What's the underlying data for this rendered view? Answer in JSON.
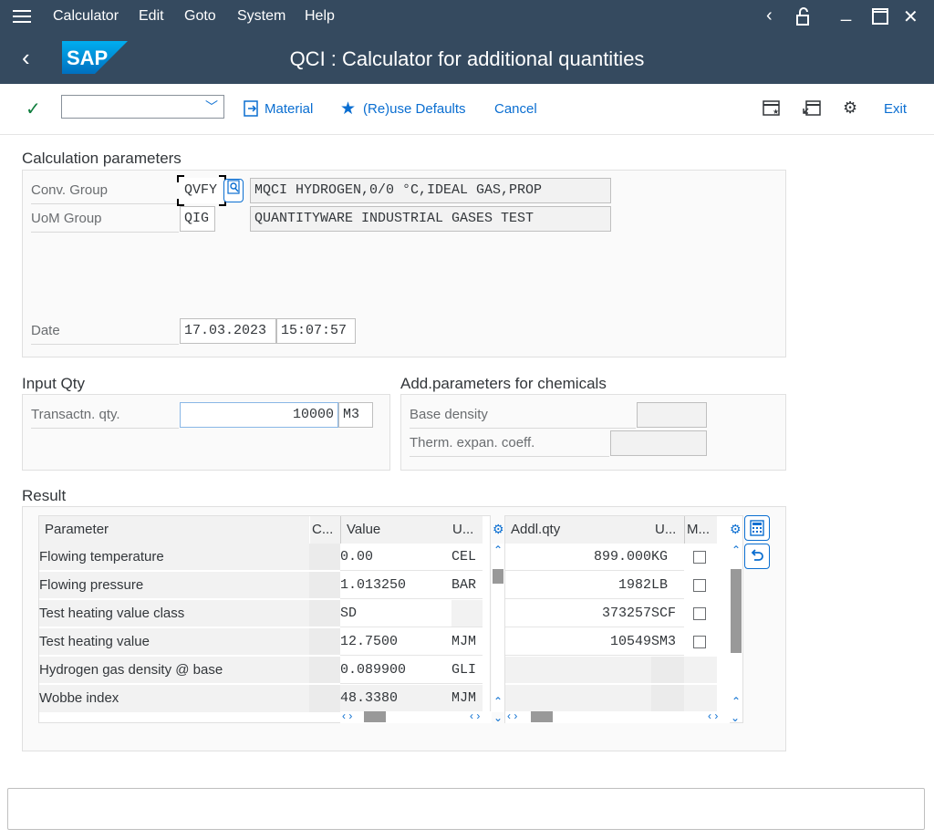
{
  "menu": {
    "items": [
      "Calculator",
      "Edit",
      "Goto",
      "System",
      "Help"
    ]
  },
  "title": "QCI : Calculator for additional quantities",
  "logo_text": "SAP",
  "toolbar": {
    "material": "Material",
    "reuse_defaults": "(Re)use Defaults",
    "cancel": "Cancel",
    "exit": "Exit",
    "command_value": ""
  },
  "calc_params": {
    "title": "Calculation parameters",
    "conv_group_label": "Conv. Group",
    "conv_group_value": "QVFY",
    "conv_group_desc": "MQCI HYDROGEN,0/0 °C,IDEAL GAS,PROP",
    "uom_group_label": "UoM Group",
    "uom_group_value": "QIG",
    "uom_group_desc": "QUANTITYWARE INDUSTRIAL GASES TEST",
    "date_label": "Date",
    "date_value": "17.03.2023",
    "time_value": "15:07:57"
  },
  "input_qty": {
    "title": "Input Qty",
    "label": "Transactn. qty.",
    "value": "10000",
    "unit": "M3"
  },
  "add_params": {
    "title": "Add.parameters for chemicals",
    "base_density_label": "Base density",
    "base_density_value": "",
    "therm_label": "Therm. expan. coeff.",
    "therm_value": ""
  },
  "result": {
    "title": "Result",
    "params_headers": [
      "Parameter",
      "C...",
      "Value",
      "U..."
    ],
    "params_rows": [
      {
        "parameter": "Flowing temperature",
        "value": "0.00",
        "unit": "CEL"
      },
      {
        "parameter": "Flowing pressure",
        "value": "1.013250",
        "unit": "BAR"
      },
      {
        "parameter": "Test heating value class",
        "value": "SD",
        "unit": ""
      },
      {
        "parameter": "Test heating value",
        "value": "12.7500",
        "unit": "MJM"
      },
      {
        "parameter": "Hydrogen gas density @ base",
        "value": "0.089900",
        "unit": "GLI"
      },
      {
        "parameter": "Wobbe index",
        "value": "48.3380",
        "unit": "MJM"
      }
    ],
    "qty_headers": [
      "Addl.qty",
      "U...",
      "M..."
    ],
    "qty_rows": [
      {
        "qty": "899.000",
        "unit": "KG"
      },
      {
        "qty": "1982",
        "unit": "LB"
      },
      {
        "qty": "373257",
        "unit": "SCF"
      },
      {
        "qty": "10549",
        "unit": "SM3"
      }
    ]
  },
  "status_text": "",
  "colors": {
    "shell": "#354a5f",
    "accent": "#0a6ed1",
    "check": "#107e3e"
  }
}
